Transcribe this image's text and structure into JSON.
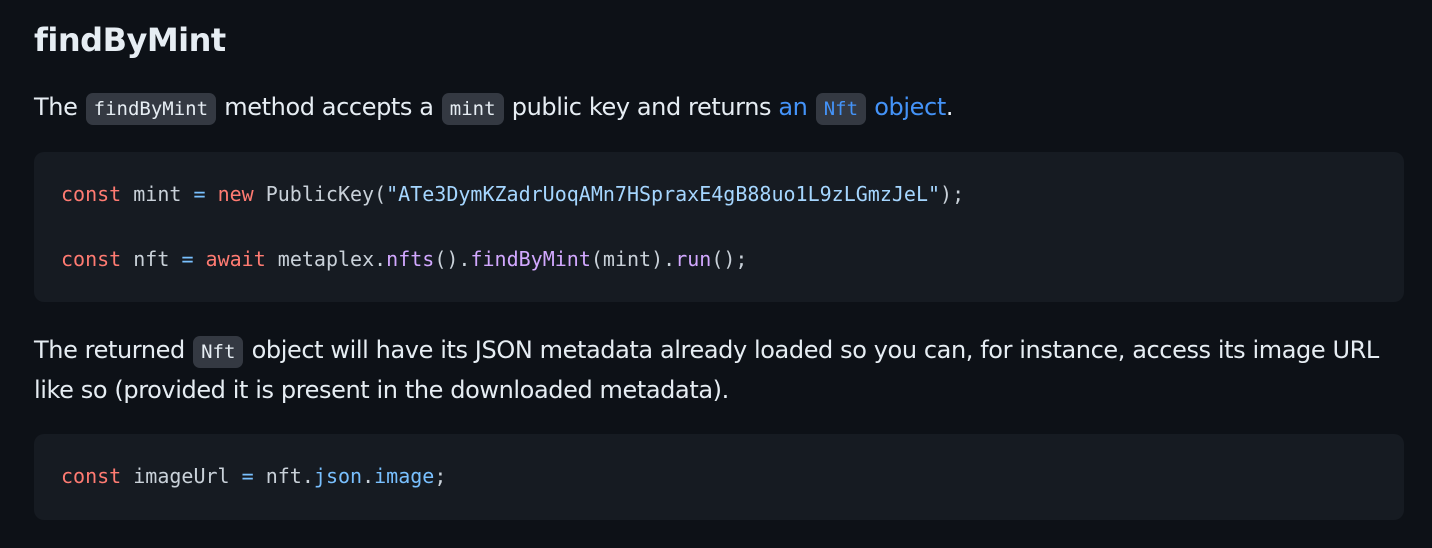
{
  "heading": "findByMint",
  "paragraph1": {
    "t1": "The ",
    "code1": "findByMint",
    "t2": " method accepts a ",
    "code2": "mint",
    "t3": " public key and returns ",
    "link_t1": "an ",
    "link_code": "Nft",
    "link_t2": " object",
    "t4": "."
  },
  "codeblock1": {
    "line1": {
      "kw1": "const",
      "var1": " mint ",
      "op1": "=",
      "sp1": " ",
      "kw2": "new",
      "cls": " PublicKey(",
      "str": "\"ATe3DymKZadrUoqAMn7HSpraxE4gB88uo1L9zLGmzJeL\"",
      "end": ");"
    },
    "line2": {
      "kw1": "const",
      "var1": " nft ",
      "op1": "=",
      "sp1": " ",
      "kw2": "await",
      "obj": " metaplex.",
      "fn1": "nfts",
      "p1": "().",
      "fn2": "findByMint",
      "p2": "(mint).",
      "fn3": "run",
      "end": "();"
    }
  },
  "paragraph2": {
    "t1": "The returned ",
    "code1": "Nft",
    "t2": " object will have its JSON metadata already loaded so you can, for instance, access its image URL like so (provided it is present in the downloaded metadata)."
  },
  "codeblock2": {
    "line1": {
      "kw1": "const",
      "var1": " imageUrl ",
      "op1": "=",
      "obj": " nft.",
      "prop1": "json",
      "dot": ".",
      "prop2": "image",
      "end": ";"
    }
  }
}
